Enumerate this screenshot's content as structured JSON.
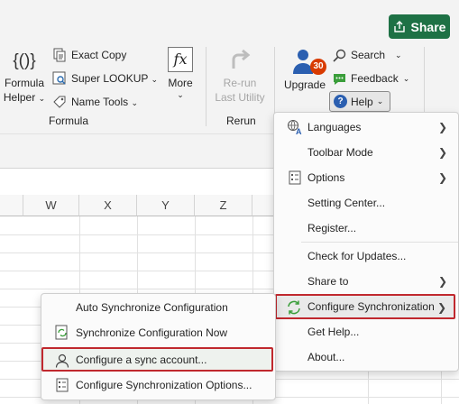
{
  "header": {
    "share_label": "Share"
  },
  "ribbon": {
    "formula_helper": {
      "line1": "Formula",
      "line2": "Helper",
      "icon_text": "{()}"
    },
    "exact_copy": "Exact Copy",
    "super_lookup": "Super LOOKUP",
    "name_tools": "Name Tools",
    "more": {
      "label": "More",
      "icon_text": "fx"
    },
    "formula_group": "Formula",
    "rerun": {
      "line1": "Re-run",
      "line2": "Last Utility"
    },
    "rerun_group": "Rerun",
    "upgrade": {
      "label": "Upgrade",
      "badge": "30"
    },
    "search": "Search",
    "feedback": "Feedback",
    "help": "Help"
  },
  "sheet": {
    "columns": [
      "W",
      "X",
      "Y",
      "Z"
    ]
  },
  "help_menu": {
    "items": [
      {
        "label": "Languages",
        "has_submenu": true,
        "icon": "languages-icon"
      },
      {
        "label": "Toolbar Mode",
        "has_submenu": true,
        "icon": ""
      },
      {
        "label": "Options",
        "has_submenu": true,
        "icon": "options-icon"
      },
      {
        "label": "Setting Center...",
        "has_submenu": false,
        "icon": ""
      },
      {
        "label": "Register...",
        "has_submenu": false,
        "icon": ""
      },
      {
        "label": "Check for Updates...",
        "has_submenu": false,
        "icon": ""
      },
      {
        "label": "Share to",
        "has_submenu": true,
        "icon": ""
      },
      {
        "label": "Configure Synchronization",
        "has_submenu": true,
        "icon": "sync-icon"
      },
      {
        "label": "Get Help...",
        "has_submenu": false,
        "icon": ""
      },
      {
        "label": "About...",
        "has_submenu": false,
        "icon": ""
      }
    ]
  },
  "sync_menu": {
    "items": [
      {
        "label": "Auto Synchronize Configuration",
        "icon": ""
      },
      {
        "label": "Synchronize Configuration Now",
        "icon": "sync-now-icon"
      },
      {
        "label": "Configure a sync account...",
        "icon": "user-icon"
      },
      {
        "label": "Configure Synchronization Options...",
        "icon": "options-icon"
      }
    ]
  },
  "colors": {
    "share": "#1e7145",
    "highlight_border": "#c0282e",
    "sync_green": "#3a9e3a",
    "badge": "#d83b01"
  }
}
